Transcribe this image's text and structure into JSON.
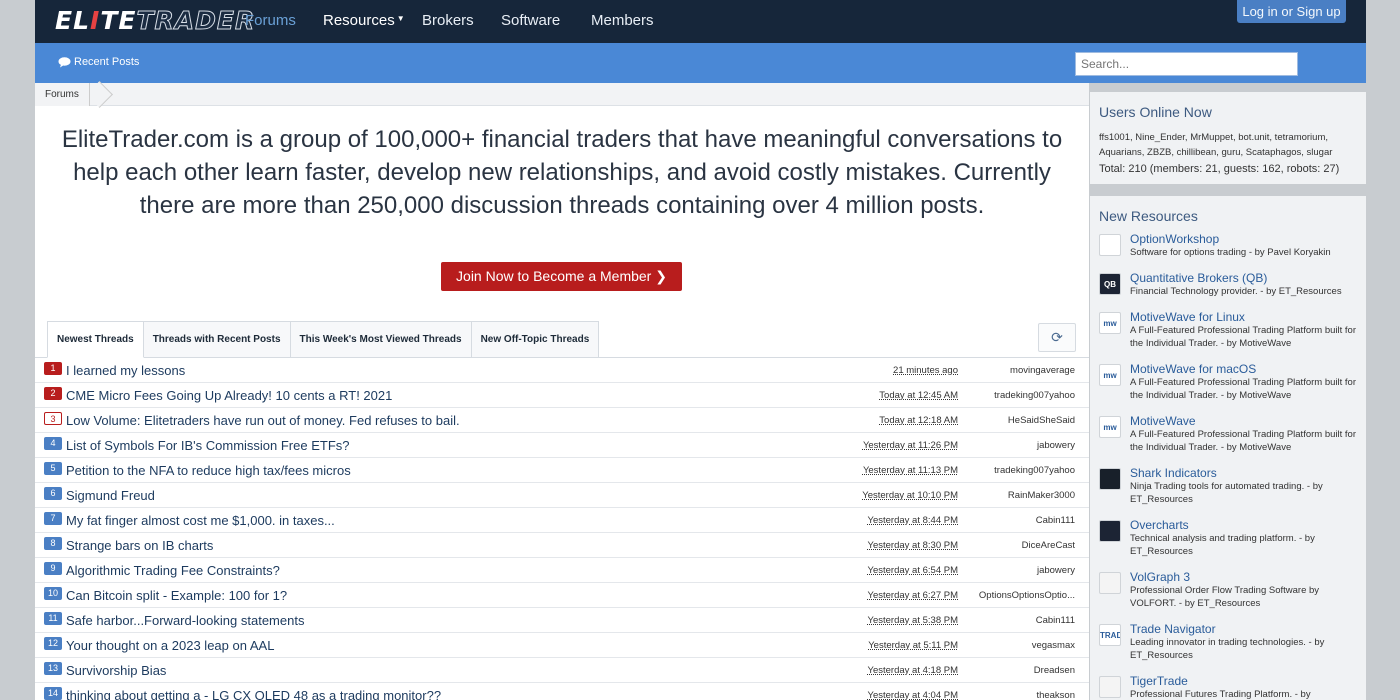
{
  "header": {
    "logo_main": "EL",
    "logo_i": "I",
    "logo_rest": "TE",
    "logo_trader": "TRADER",
    "nav": [
      {
        "label": "Forums"
      },
      {
        "label": "Resources"
      },
      {
        "label": "Brokers"
      },
      {
        "label": "Software"
      },
      {
        "label": "Members"
      }
    ],
    "login_label": "Log in or Sign up"
  },
  "subbar": {
    "recent_posts": "Recent Posts",
    "search_placeholder": "Search..."
  },
  "breadcrumb": "Forums",
  "intro": "EliteTrader.com is a group of 100,000+ financial traders that have meaningful conversations to help each other learn faster, develop new relationships, and avoid costly mistakes. Currently there are more than 250,000 discussion threads containing over 4 million posts.",
  "join_button": "Join Now to Become a Member",
  "tabs": [
    {
      "label": "Newest Threads"
    },
    {
      "label": "Threads with Recent Posts"
    },
    {
      "label": "This Week's Most Viewed Threads"
    },
    {
      "label": "New Off-Topic Threads"
    }
  ],
  "threads": [
    {
      "num": "1",
      "title": "I learned my lessons",
      "date": "21 minutes ago",
      "user": "movingaverage"
    },
    {
      "num": "2",
      "title": "CME Micro Fees Going Up Already! 10 cents a RT! 2021",
      "date": "Today at 12:45 AM",
      "user": "tradeking007yahoo"
    },
    {
      "num": "3",
      "title": "Low Volume: Elitetraders have run out of money. Fed refuses to bail.",
      "date": "Today at 12:18 AM",
      "user": "HeSaidSheSaid"
    },
    {
      "num": "4",
      "title": "List of Symbols For IB's Commission Free ETFs?",
      "date": "Yesterday at 11:26 PM",
      "user": "jabowery"
    },
    {
      "num": "5",
      "title": "Petition to the NFA to reduce high tax/fees micros",
      "date": "Yesterday at 11:13 PM",
      "user": "tradeking007yahoo"
    },
    {
      "num": "6",
      "title": "Sigmund Freud",
      "date": "Yesterday at 10:10 PM",
      "user": "RainMaker3000"
    },
    {
      "num": "7",
      "title": "My fat finger almost cost me $1,000. in taxes...",
      "date": "Yesterday at 8:44 PM",
      "user": "Cabin111"
    },
    {
      "num": "8",
      "title": "Strange bars on IB charts",
      "date": "Yesterday at 8:30 PM",
      "user": "DiceAreCast"
    },
    {
      "num": "9",
      "title": "Algorithmic Trading Fee Constraints?",
      "date": "Yesterday at 6:54 PM",
      "user": "jabowery"
    },
    {
      "num": "10",
      "title": "Can Bitcoin split - Example: 100 for 1?",
      "date": "Yesterday at 6:27 PM",
      "user": "OptionsOptionsOptio..."
    },
    {
      "num": "11",
      "title": "Safe harbor...Forward-looking statements",
      "date": "Yesterday at 5:38 PM",
      "user": "Cabin111"
    },
    {
      "num": "12",
      "title": "Your thought on a 2023 leap on AAL",
      "date": "Yesterday at 5:11 PM",
      "user": "vegasmax"
    },
    {
      "num": "13",
      "title": "Survivorship Bias",
      "date": "Yesterday at 4:18 PM",
      "user": "Dreadsen"
    },
    {
      "num": "14",
      "title": "thinking about getting a - LG CX OLED 48 as a trading monitor??",
      "date": "Yesterday at 4:04 PM",
      "user": "theakson"
    }
  ],
  "users_online": {
    "title": "Users Online Now",
    "list": "ffs1001, Nine_Ender, MrMuppet, bot.unit, tetramorium, Aquarians, ZBZB, chillibean, guru, Scataphagos, slugar",
    "total": "Total: 210 (members: 21, guests: 162, robots: 27)"
  },
  "new_resources": {
    "title": "New Resources",
    "items": [
      {
        "name": "OptionWorkshop",
        "desc": "Software for options trading - by Pavel Koryakin",
        "icon": "optionworkshop-icon",
        "icon_text": "",
        "icon_color": "#ffffff"
      },
      {
        "name": "Quantitative Brokers (QB)",
        "desc": "Financial Technology provider. - by ET_Resources",
        "icon": "qb-icon",
        "icon_text": "QB",
        "icon_color": "#1c2434"
      },
      {
        "name": "MotiveWave for Linux",
        "desc": "A Full-Featured Professional Trading Platform built for the Individual Trader. - by MotiveWave",
        "icon": "motivewave-icon",
        "icon_text": "mw",
        "icon_color": "#ffffff"
      },
      {
        "name": "MotiveWave for macOS",
        "desc": "A Full-Featured Professional Trading Platform built for the Individual Trader. - by MotiveWave",
        "icon": "motivewave-icon",
        "icon_text": "mw",
        "icon_color": "#ffffff"
      },
      {
        "name": "MotiveWave",
        "desc": "A Full-Featured Professional Trading Platform built for the Individual Trader. - by MotiveWave",
        "icon": "motivewave-icon",
        "icon_text": "mw",
        "icon_color": "#ffffff"
      },
      {
        "name": "Shark Indicators",
        "desc": "Ninja Trading tools for automated trading. - by ET_Resources",
        "icon": "shark-icon",
        "icon_text": "",
        "icon_color": "#18202a"
      },
      {
        "name": "Overcharts",
        "desc": "Technical analysis and trading platform. - by ET_Resources",
        "icon": "overcharts-icon",
        "icon_text": "",
        "icon_color": "#1c2434"
      },
      {
        "name": "VolGraph 3",
        "desc": "Professional Order Flow Trading Software by VOLFORT. - by ET_Resources",
        "icon": "volgraph-icon",
        "icon_text": "",
        "icon_color": "#f4f4f4"
      },
      {
        "name": "Trade Navigator",
        "desc": "Leading innovator in trading technologies. - by ET_Resources",
        "icon": "tradenavigator-icon",
        "icon_text": "TRADE",
        "icon_color": "#ffffff"
      },
      {
        "name": "TigerTrade",
        "desc": "Professional Futures Trading Platform. - by",
        "icon": "tigertrade-icon",
        "icon_text": "",
        "icon_color": "#f4f4f4"
      }
    ]
  }
}
